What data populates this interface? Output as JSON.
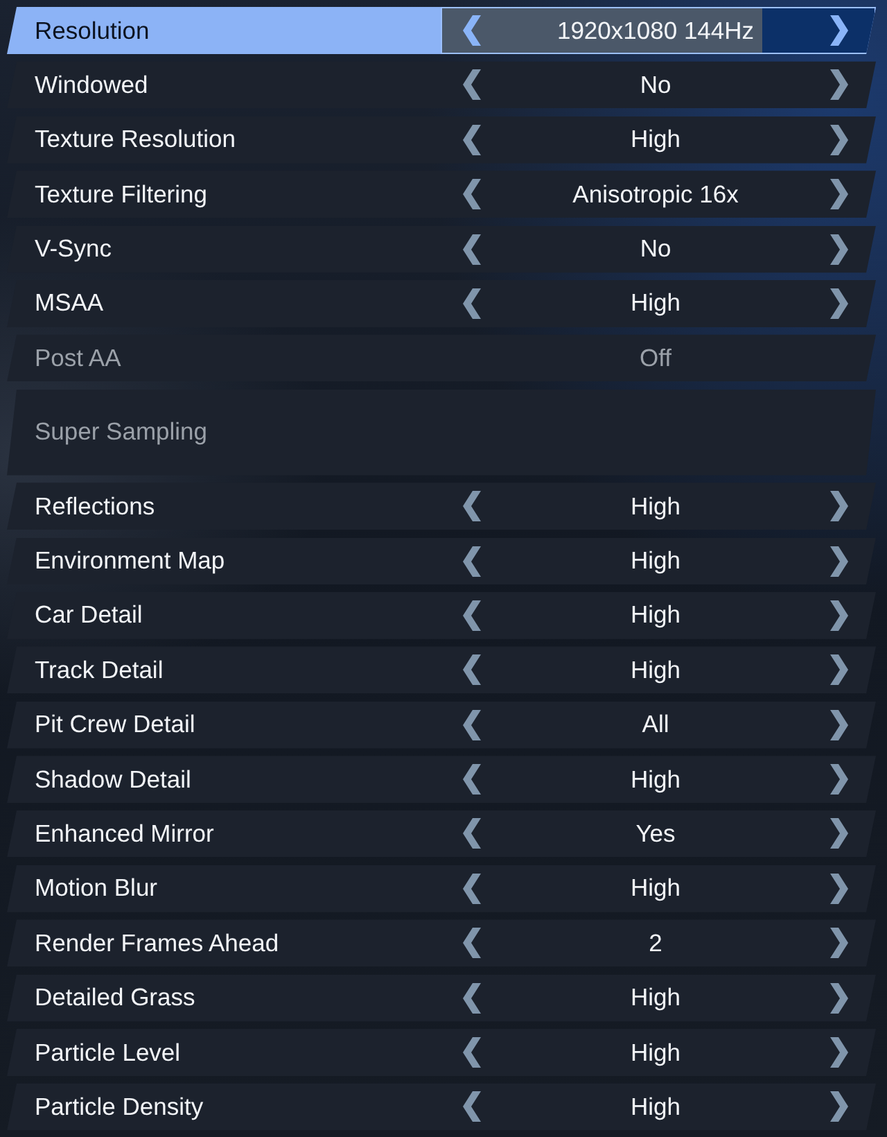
{
  "settings": [
    {
      "kind": "choice",
      "label": "Resolution",
      "value": "1920x1080 144Hz",
      "selected": true,
      "disabled": false
    },
    {
      "kind": "choice",
      "label": "Windowed",
      "value": "No",
      "selected": false,
      "disabled": false
    },
    {
      "kind": "choice",
      "label": "Texture Resolution",
      "value": "High",
      "selected": false,
      "disabled": false
    },
    {
      "kind": "choice",
      "label": "Texture Filtering",
      "value": "Anisotropic 16x",
      "selected": false,
      "disabled": false
    },
    {
      "kind": "choice",
      "label": "V-Sync",
      "value": "No",
      "selected": false,
      "disabled": false
    },
    {
      "kind": "choice",
      "label": "MSAA",
      "value": "High",
      "selected": false,
      "disabled": false
    },
    {
      "kind": "choice",
      "label": "Post AA",
      "value": "Off",
      "selected": false,
      "disabled": true
    },
    {
      "kind": "label",
      "label": "Super Sampling",
      "selected": false,
      "disabled": true
    },
    {
      "kind": "choice",
      "label": "Reflections",
      "value": "High",
      "selected": false,
      "disabled": false
    },
    {
      "kind": "choice",
      "label": "Environment Map",
      "value": "High",
      "selected": false,
      "disabled": false
    },
    {
      "kind": "choice",
      "label": "Car Detail",
      "value": "High",
      "selected": false,
      "disabled": false
    },
    {
      "kind": "choice",
      "label": "Track Detail",
      "value": "High",
      "selected": false,
      "disabled": false
    },
    {
      "kind": "choice",
      "label": "Pit Crew Detail",
      "value": "All",
      "selected": false,
      "disabled": false
    },
    {
      "kind": "choice",
      "label": "Shadow Detail",
      "value": "High",
      "selected": false,
      "disabled": false
    },
    {
      "kind": "choice",
      "label": "Enhanced Mirror",
      "value": "Yes",
      "selected": false,
      "disabled": false
    },
    {
      "kind": "choice",
      "label": "Motion Blur",
      "value": "High",
      "selected": false,
      "disabled": false
    },
    {
      "kind": "choice",
      "label": "Render Frames Ahead",
      "value": "2",
      "selected": false,
      "disabled": false
    },
    {
      "kind": "choice",
      "label": "Detailed Grass",
      "value": "High",
      "selected": false,
      "disabled": false
    },
    {
      "kind": "choice",
      "label": "Particle Level",
      "value": "High",
      "selected": false,
      "disabled": false
    },
    {
      "kind": "choice",
      "label": "Particle Density",
      "value": "High",
      "selected": false,
      "disabled": false
    }
  ]
}
